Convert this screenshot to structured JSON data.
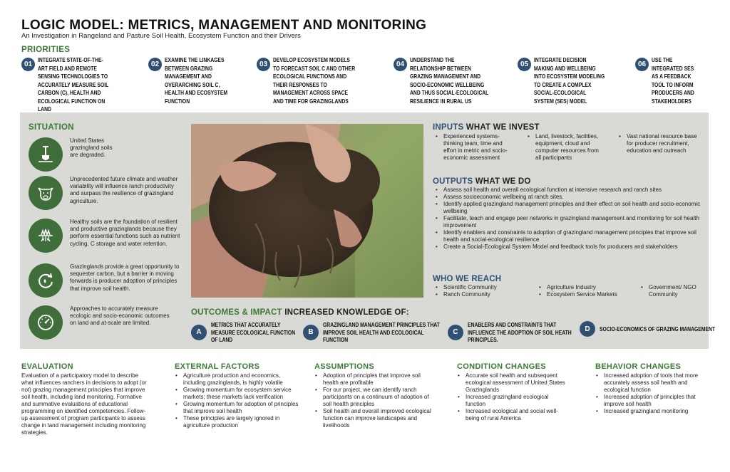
{
  "title": "LOGIC MODEL: METRICS, MANAGEMENT AND MONITORING",
  "subtitle": "An Investigation in Rangeland and Pasture Soil Health, Ecosystem Function and their Drivers",
  "colors": {
    "green": "#3a7a34",
    "navy": "#2f4f73",
    "panel": "#d9d9d6"
  },
  "priorities": {
    "heading": "PRIORITIES",
    "items": [
      {
        "num": "01",
        "text": "Integrate state-of-the-art field and remote sensing technologies to accurately measure soil carbon (C), health and ecological function on land"
      },
      {
        "num": "02",
        "text": "Examine the linkages between grazing management and overarching soil C, health and ecosystem function"
      },
      {
        "num": "03",
        "text": "Develop ecosystem models to forecast soil C and other ecological functions and their responses to management across space and time for grazinglands"
      },
      {
        "num": "04",
        "text": "Understand the relationship between grazing management and socio-economic wellbeing and thus social-ecological resilience in rural US"
      },
      {
        "num": "05",
        "text": "Integrate decision making and wellbeing into ecosystem modeling to create a complex social-ecological system (SES) model"
      },
      {
        "num": "06",
        "text": "Use the integrated SES as a feedback tool to inform producers and stakeholders"
      }
    ]
  },
  "situation": {
    "heading": "SITUATION",
    "items": [
      {
        "icon": "shovel-icon",
        "text": "United States grazingland soils are degraded."
      },
      {
        "icon": "cow-icon",
        "text": "Unprecedented future climate and weather variability will influence ranch productivity and surpass the resilience of grazingland agriculture."
      },
      {
        "icon": "grass-roots-icon",
        "text": "Healthy soils are the foundation of resilient and productive grazinglands because they perform essential functions such as nutrient cycling, C storage and water retention."
      },
      {
        "icon": "cycle-arrow-icon",
        "text": "Grazinglands provide a great opportunity to sequester carbon, but a barrier in moving forwards is producer adoption of principles that improve soil health."
      },
      {
        "icon": "gauge-icon",
        "text": "Approaches to accurately measure ecologic and socio-economic outcomes on land and at-scale are limited."
      }
    ]
  },
  "inputs": {
    "heading": "INPUTS",
    "sub": "WHAT WE INVEST",
    "items": [
      "Experienced systems-thinking team, time and effort in metric and socio-economic assessment",
      "Land, livestock, facilities, equipment, cloud and computer resources from all participants",
      "Vast national resource base for producer recruitment, education and outreach"
    ]
  },
  "outputs": {
    "heading": "OUTPUTS",
    "sub": "WHAT WE DO",
    "items": [
      "Assess soil health and overall ecological function at intensive research and ranch sites",
      "Assess socioeconomic wellbeing at ranch sites.",
      "Identify applied grazingland management principles and their effect on soil health and socio-economic wellbeing",
      "Facilitate, teach and engage peer networks in grazingland management and monitoring for soil health improvement",
      "Identify enablers and constraints to adoption of grazingland management principles that improve soil health and social-ecological resilience",
      "Create a Social-Ecological System Model and feedback tools for producers and stakeholders"
    ]
  },
  "reach": {
    "heading": "WHO WE REACH",
    "col1": [
      "Scientific Community",
      "Ranch Community"
    ],
    "col2": [
      "Agriculture Industry",
      "Ecosystem Service Markets"
    ],
    "col3": [
      "Government/ NGO Community"
    ]
  },
  "outcomes": {
    "heading": "OUTCOMES & IMPACT",
    "sub": "INCREASED KNOWLEDGE OF:",
    "items": [
      {
        "letter": "A",
        "text": "Metrics that accurately measure ecological function of land"
      },
      {
        "letter": "B",
        "text": "Grazingland management principles that improve soil health and ecological function"
      },
      {
        "letter": "C",
        "text": "Enablers and constraints that influence the adoption of soil heath principles."
      },
      {
        "letter": "D",
        "text": "Socio-economics of grazing management"
      }
    ]
  },
  "evaluation": {
    "heading": "EVALUATION",
    "text": "Evaluation of a participatory model to describe what influences ranchers in decisions to adopt (or not) grazing management principles that improve soil health, including land monitoring. Formative and summative evaluations of educational programming on identified competencies. Follow-up assessment of program participants to assess change in land management including monitoring strategies."
  },
  "external": {
    "heading": "EXTERNAL FACTORS",
    "items": [
      "Agriculture production and economics, including grazinglands, is highly volatile",
      "Growing momentum for ecosystem service markets; these markets lack verification",
      "Growing momentum for adoption of principles that improve soil health",
      "These principles are largely ignored in agriculture production"
    ]
  },
  "assumptions": {
    "heading": "ASSUMPTIONS",
    "items": [
      "Adoption of principles that improve soil health are profitable",
      "For our project, we can identify ranch participants on a continuum of adoption of soil health principles",
      "Soil health and overall improved ecological function can improve landscapes and livelihoods"
    ]
  },
  "condition": {
    "heading": "CONDITION CHANGES",
    "items": [
      "Accurate soil health and subsequent ecological assessment of United States Grazinglands",
      "Increased grazingland ecological function",
      "Increased ecological and social well-being of rural America"
    ]
  },
  "behavior": {
    "heading": "BEHAVIOR CHANGES",
    "items": [
      "Increased adoption of tools that more accurately assess soil health and ecological function",
      "Increased adoption of principles that improve soil health",
      "Increased grazingland monitoring"
    ]
  }
}
